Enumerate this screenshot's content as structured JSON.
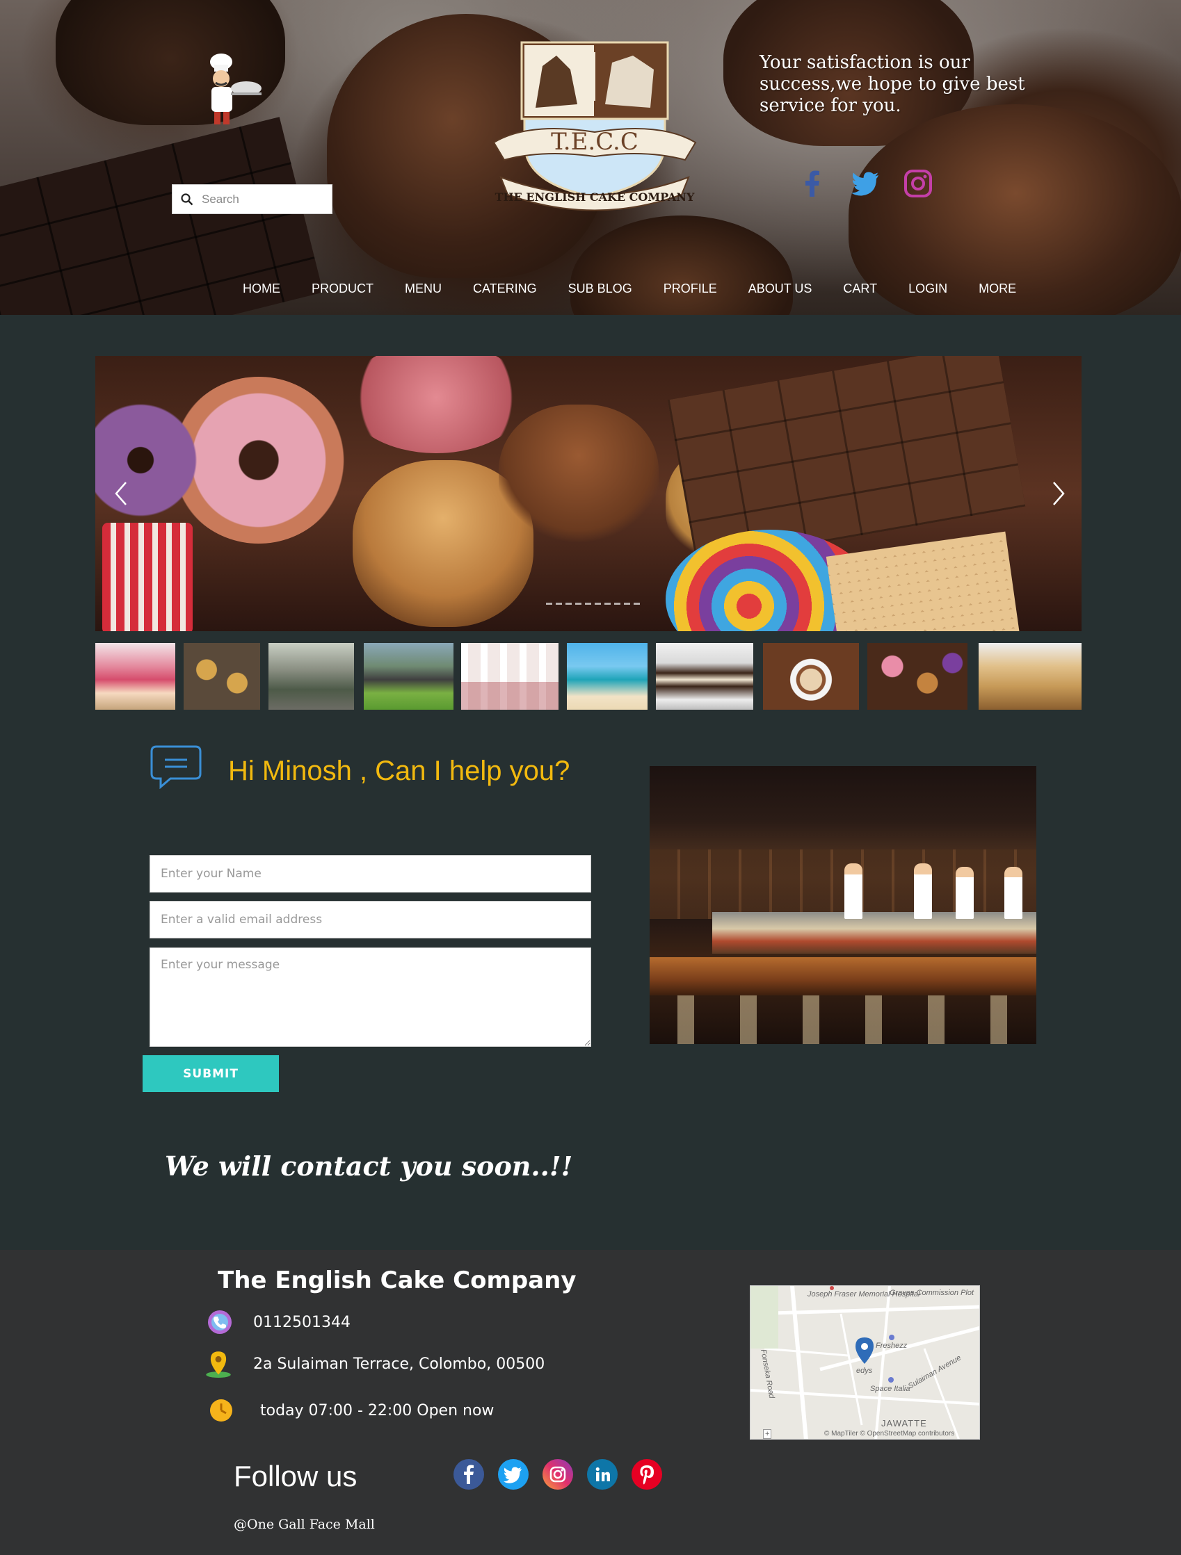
{
  "header": {
    "search_placeholder": "Search",
    "logo_text": "THE ENGLISH CAKE COMPANY",
    "logo_initials": "T.E.C.C",
    "tagline": "Your satisfaction is our success,we hope to give best service for you.",
    "social_icons": [
      "facebook-icon",
      "twitter-icon",
      "instagram-icon"
    ]
  },
  "nav": {
    "items": [
      {
        "label": "HOME"
      },
      {
        "label": "PRODUCT"
      },
      {
        "label": "MENU"
      },
      {
        "label": "CATERING"
      },
      {
        "label": "SUB BLOG"
      },
      {
        "label": "PROFILE"
      },
      {
        "label": "ABOUT US"
      },
      {
        "label": "CART"
      },
      {
        "label": "LOGIN"
      },
      {
        "label": "MORE"
      }
    ]
  },
  "carousel": {
    "slide_count": 10,
    "active_slide": 1
  },
  "contact": {
    "title": "Hi Minosh , Can I help you?",
    "name_placeholder": "Enter your Name",
    "email_placeholder": "Enter a valid email address",
    "message_placeholder": "Enter your message",
    "submit_label": "SUBMIT",
    "confirmation": "We will contact you soon..!!"
  },
  "footer": {
    "company": "The English Cake Company",
    "phone": "0112501344",
    "address": "2a Sulaiman Terrace, Colombo, 00500",
    "hours": "today 07:00 - 22:00 Open now",
    "follow_label": "Follow us",
    "social_icons": [
      "facebook-icon",
      "twitter-icon",
      "instagram-icon",
      "linkedin-icon",
      "pinterest-icon"
    ],
    "location": "@One Gall Face Mall"
  },
  "map": {
    "labels": [
      "Joseph Fraser Memorial Hospital",
      "Graves Commission Plot",
      "Fonseka Road",
      "Freshezz",
      "Sulaiman Avenue",
      "edys",
      "Space Italia",
      "JAWATTE"
    ],
    "attribution": "© MapTiler © OpenStreetMap contributors",
    "zoom_control": "+"
  },
  "colors": {
    "page_bg": "#263031",
    "footer_bg": "#313233",
    "accent_yellow": "#f2b90f",
    "submit_teal": "#2ec8bf"
  }
}
